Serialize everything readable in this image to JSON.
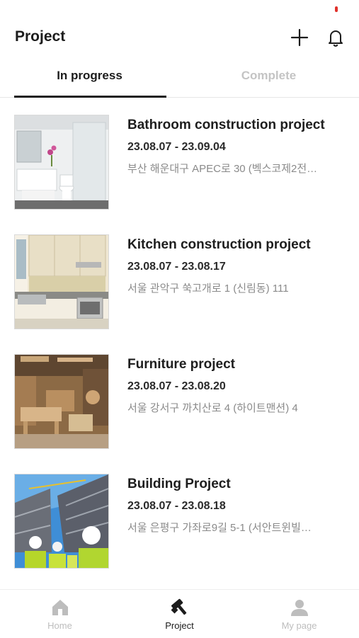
{
  "header": {
    "title": "Project",
    "add_icon": "plus-icon",
    "bell_icon": "bell-icon"
  },
  "tabs": [
    {
      "label": "In progress",
      "active": true
    },
    {
      "label": "Complete",
      "active": false
    }
  ],
  "projects": [
    {
      "title": "Bathroom construction project",
      "dates": "23.08.07 - 23.09.04",
      "address": "부산 해운대구 APEC로 30 (벡스코제2전…",
      "thumbnail": "bathroom-photo"
    },
    {
      "title": "Kitchen construction project",
      "dates": "23.08.07 - 23.08.17",
      "address": "서울 관악구 쑥고개로 1 (신림동) 111",
      "thumbnail": "kitchen-photo"
    },
    {
      "title": "Furniture project",
      "dates": "23.08.07 - 23.08.20",
      "address": "서울 강서구 까치산로 4 (하이트맨션) 4",
      "thumbnail": "workshop-photo"
    },
    {
      "title": "Building Project",
      "dates": "23.08.07 - 23.08.18",
      "address": "서울 은평구 가좌로9길 5-1 (서안트윈빌…",
      "thumbnail": "construction-site-photo"
    }
  ],
  "bottom_nav": [
    {
      "label": "Home",
      "icon": "home-icon",
      "active": false
    },
    {
      "label": "Project",
      "icon": "hammer-icon",
      "active": true
    },
    {
      "label": "My page",
      "icon": "person-icon",
      "active": false
    }
  ],
  "colors": {
    "active_text": "#1c1c1c",
    "inactive_text": "#c4c4c4",
    "secondary_text": "#8a8a8a",
    "status_indicator": "#e0312b"
  }
}
